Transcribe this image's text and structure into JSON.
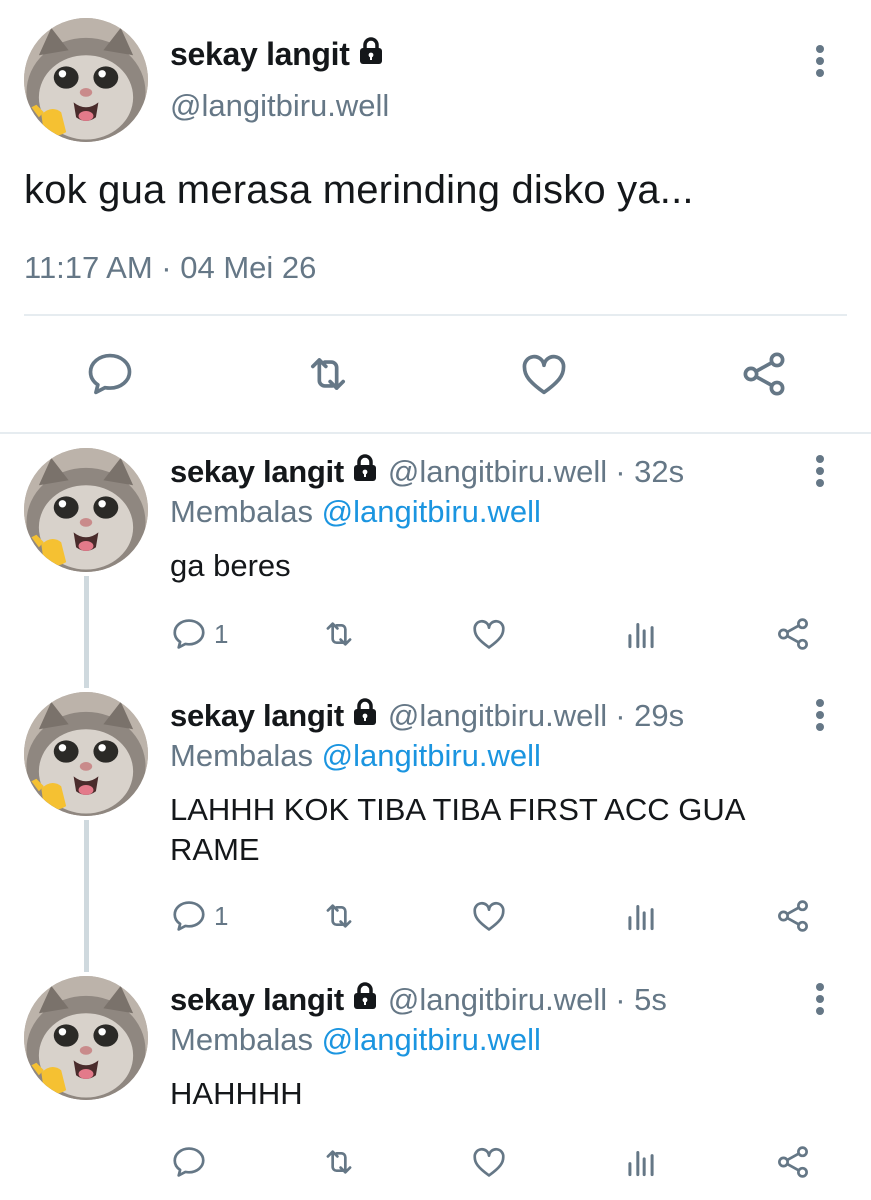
{
  "tweet": {
    "name": "sekay langit",
    "handle": "@langitbiru.well",
    "text": "kok gua merasa merinding disko ya...",
    "meta": "11:17 AM · 04 Mei 26",
    "icons": [
      "lock-icon",
      "more-vertical-icon",
      "reply-icon",
      "retweet-icon",
      "like-icon",
      "share-icon"
    ]
  },
  "replies": [
    {
      "name": "sekay langit",
      "handle": "@langitbiru.well",
      "time": "· 32s",
      "replying_label": "Membalas",
      "replying_to": "@langitbiru.well",
      "text": "ga beres",
      "reply_count": "1"
    },
    {
      "name": "sekay langit",
      "handle": "@langitbiru.well",
      "time": "· 29s",
      "replying_label": "Membalas",
      "replying_to": "@langitbiru.well",
      "text": "LAHHH KOK TIBA TIBA FIRST ACC GUA RAME",
      "reply_count": "1"
    },
    {
      "name": "sekay langit",
      "handle": "@langitbiru.well",
      "time": "· 5s",
      "replying_label": "Membalas",
      "replying_to": "@langitbiru.well",
      "text": "HAHHHH",
      "reply_count": ""
    }
  ],
  "colors": {
    "text": "#14171a",
    "secondary": "#657786",
    "link": "#1b95e0",
    "divider": "#e6ecf0"
  }
}
